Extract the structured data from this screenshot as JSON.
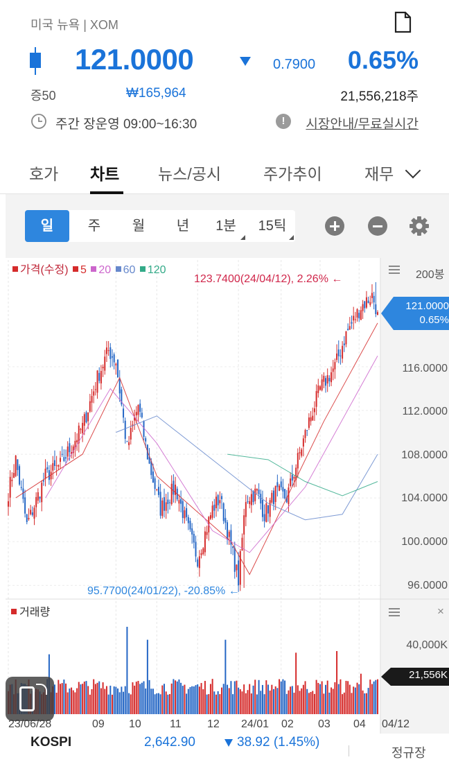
{
  "header": {
    "title": "미국 뉴욕 | XOM",
    "price": "121.0000",
    "change": "0.7900",
    "change_pct": "0.65%",
    "margin": "증50",
    "krw_price": "₩165,964",
    "volume": "21,556,218주",
    "trading_hours": "주간 장운영 09:00~16:30",
    "market_link": "시장안내/무료실시간"
  },
  "tabs": [
    {
      "label": "호가"
    },
    {
      "label": "차트"
    },
    {
      "label": "뉴스/공시"
    },
    {
      "label": "주가추이"
    },
    {
      "label": "재무"
    }
  ],
  "periods": [
    {
      "label": "일"
    },
    {
      "label": "주"
    },
    {
      "label": "월"
    },
    {
      "label": "년"
    },
    {
      "label": "1분"
    },
    {
      "label": "15틱"
    }
  ],
  "legend": {
    "price": "가격(수정)",
    "ma5": "5",
    "ma20": "20",
    "ma60": "60",
    "ma120": "120",
    "bars": "200봉"
  },
  "colors": {
    "up": "#d52b2b",
    "down": "#2466c5",
    "ma5": "#d52b2b",
    "ma20": "#cc66cc",
    "ma60": "#6688cc",
    "ma120": "#33aa88",
    "accent": "#2e86de"
  },
  "annotations": {
    "high": "123.7400(24/04/12), 2.26% ←",
    "low": "95.7700(24/01/22), -20.85% ←"
  },
  "price_tag": {
    "price": "121.0000",
    "pct": "0.65%"
  },
  "y_axis": [
    "116.0000",
    "112.0000",
    "108.0000",
    "104.0000",
    "100.0000",
    "96.0000"
  ],
  "volume_panel": {
    "label": "거래량",
    "axis": "40,000K",
    "current": "21,556K"
  },
  "x_axis": [
    "23/06/28",
    "09",
    "10",
    "11",
    "12",
    "24/01",
    "02",
    "03",
    "04",
    "04/12"
  ],
  "footer": {
    "index_name": "KOSPI",
    "index_value": "2,642.90",
    "index_change": "38.92 (1.45%)",
    "session": "정규장"
  },
  "chart_data": {
    "type": "candlestick",
    "title": "",
    "xlabel": "",
    "ylabel": "",
    "ylim": [
      95,
      124.5
    ],
    "volume_ylim": [
      0,
      60000
    ],
    "bars": 200,
    "x_range": [
      "23/06/28",
      "24/04/12"
    ],
    "x_ticks": [
      "23/06/28",
      "09",
      "10",
      "11",
      "12",
      "24/01",
      "02",
      "03",
      "04",
      "04/12"
    ],
    "y_ticks": [
      96,
      100,
      104,
      108,
      112,
      116
    ],
    "high": {
      "value": 123.74,
      "date": "24/04/12",
      "pct": 2.26
    },
    "low": {
      "value": 95.77,
      "date": "24/01/22",
      "pct": -20.85
    },
    "last_close": 121.0,
    "last_volume_k": 21556,
    "close_anchors": [
      [
        0,
        104.5
      ],
      [
        4,
        107.5
      ],
      [
        10,
        101.5
      ],
      [
        20,
        106.0
      ],
      [
        28,
        107.0
      ],
      [
        40,
        110.5
      ],
      [
        48,
        115.0
      ],
      [
        54,
        117.5
      ],
      [
        58,
        116.5
      ],
      [
        64,
        108.5
      ],
      [
        70,
        112.5
      ],
      [
        76,
        107.0
      ],
      [
        82,
        103.0
      ],
      [
        90,
        105.0
      ],
      [
        98,
        100.5
      ],
      [
        102,
        98.5
      ],
      [
        110,
        103.0
      ],
      [
        114,
        104.0
      ],
      [
        122,
        98.0
      ],
      [
        124,
        96.5
      ],
      [
        128,
        104.0
      ],
      [
        134,
        104.5
      ],
      [
        138,
        102.5
      ],
      [
        144,
        104.5
      ],
      [
        150,
        104.0
      ],
      [
        156,
        107.5
      ],
      [
        162,
        111.0
      ],
      [
        168,
        114.0
      ],
      [
        176,
        116.0
      ],
      [
        182,
        119.0
      ],
      [
        190,
        121.5
      ],
      [
        196,
        122.5
      ],
      [
        199,
        121.0
      ]
    ],
    "ma_lines": [
      {
        "name": "5",
        "points": [
          [
            4,
            104
          ],
          [
            40,
            108
          ],
          [
            60,
            115
          ],
          [
            80,
            106
          ],
          [
            120,
            100
          ],
          [
            130,
            97
          ],
          [
            150,
            104
          ],
          [
            170,
            111
          ],
          [
            199,
            120
          ]
        ]
      },
      {
        "name": "20",
        "points": [
          [
            20,
            104
          ],
          [
            55,
            114
          ],
          [
            80,
            109
          ],
          [
            110,
            101
          ],
          [
            130,
            99
          ],
          [
            160,
            105
          ],
          [
            199,
            117
          ]
        ]
      },
      {
        "name": "60",
        "points": [
          [
            58,
            110
          ],
          [
            80,
            111.5
          ],
          [
            110,
            107.5
          ],
          [
            140,
            103.5
          ],
          [
            160,
            102
          ],
          [
            180,
            102.5
          ],
          [
            199,
            108
          ]
        ]
      },
      {
        "name": "120",
        "points": [
          [
            118,
            108
          ],
          [
            140,
            107.5
          ],
          [
            160,
            105.5
          ],
          [
            180,
            104.2
          ],
          [
            199,
            105.5
          ]
        ]
      }
    ],
    "volume_spikes": [
      [
        22,
        37000
      ],
      [
        64,
        54000
      ],
      [
        75,
        46000
      ],
      [
        117,
        46000
      ],
      [
        155,
        38000
      ],
      [
        177,
        39000
      ],
      [
        190,
        25000
      ]
    ]
  }
}
